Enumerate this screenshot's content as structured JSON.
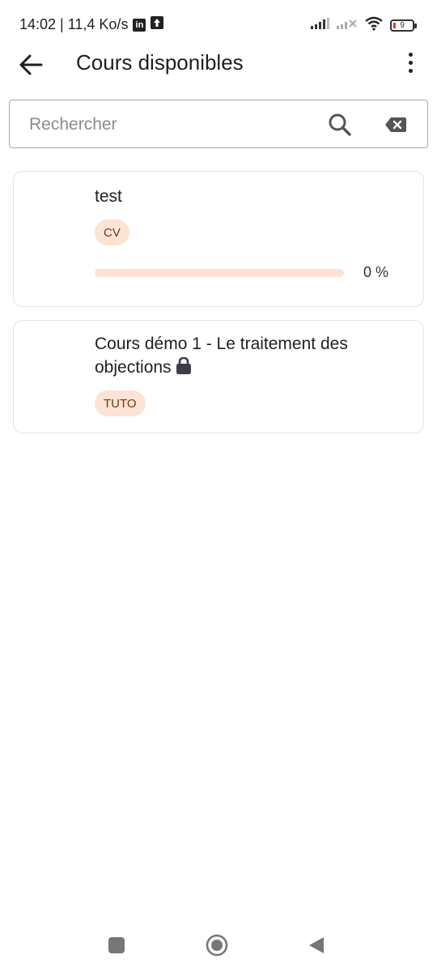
{
  "status_bar": {
    "time_speed": "14:02 | 11,4 Ko/s",
    "battery_level": "9",
    "icons": [
      "linkedin-icon",
      "upload-icon",
      "signal-icon",
      "signal-no-service-icon",
      "wifi-icon",
      "battery-icon"
    ]
  },
  "app_bar": {
    "title": "Cours disponibles",
    "back_icon": "arrow-left-icon",
    "menu_icon": "more-vertical-icon"
  },
  "search": {
    "placeholder": "Rechercher",
    "value": "",
    "search_icon": "search-icon",
    "clear_icon": "backspace-clear-icon"
  },
  "courses": [
    {
      "title": "test",
      "tag": "CV",
      "progress": 0,
      "progress_label": "0 %",
      "locked": false
    },
    {
      "title": "Cours démo 1 - Le traitement des objections",
      "tag": "TUTO",
      "locked": true,
      "lock_icon": "lock-icon"
    }
  ],
  "colors": {
    "tag_background": "#fde3d3",
    "tag_text": "#6b3a1d",
    "progress_track": "#fde3d3",
    "card_border": "#e3e3e3"
  },
  "nav_bar": {
    "icons": [
      "recents-square-icon",
      "home-circle-icon",
      "back-triangle-icon"
    ]
  }
}
